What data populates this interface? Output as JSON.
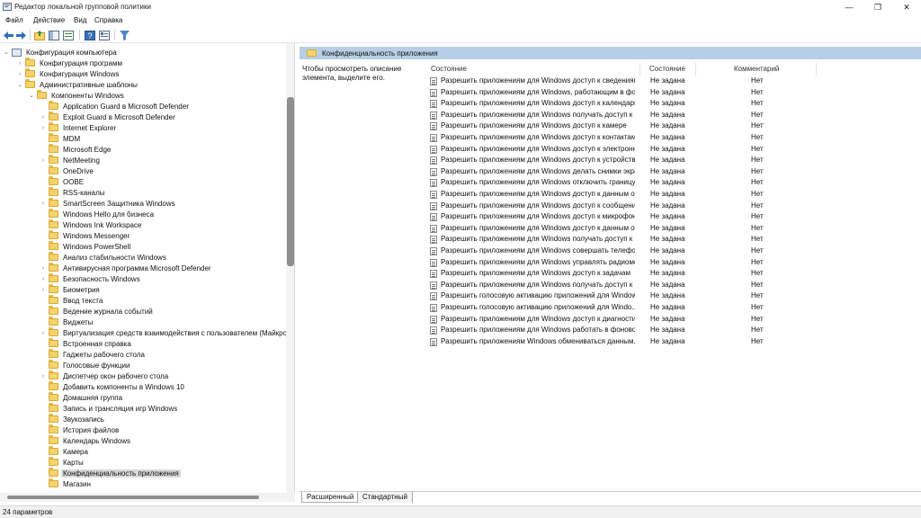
{
  "window": {
    "title": "Редактор локальной групповой политики",
    "controls": {
      "minimize": "—",
      "maximize": "❐",
      "close": "✕"
    }
  },
  "menu": [
    "Файл",
    "Действие",
    "Вид",
    "Справка"
  ],
  "toolbar": {
    "icons": [
      "back-arrow-icon",
      "forward-arrow-icon",
      "up-folder-icon",
      "show-hide-tree-icon",
      "export-list-icon",
      "help-icon",
      "properties-icon",
      "filter-icon"
    ]
  },
  "tree": [
    {
      "label": "Конфигурация компьютера",
      "level": 0,
      "exp": "⌄",
      "icon": "computer"
    },
    {
      "label": "Конфигурация программ",
      "level": 1,
      "exp": "›",
      "icon": "folder"
    },
    {
      "label": "Конфигурация Windows",
      "level": 1,
      "exp": "›",
      "icon": "folder"
    },
    {
      "label": "Административные шаблоны",
      "level": 1,
      "exp": "⌄",
      "icon": "folder"
    },
    {
      "label": "Компоненты Windows",
      "level": 2,
      "exp": "⌄",
      "icon": "folder"
    },
    {
      "label": "Application Guard в Microsoft Defender",
      "level": 3,
      "exp": "",
      "icon": "folder"
    },
    {
      "label": "Exploit Guard в Microsoft Defender",
      "level": 3,
      "exp": "›",
      "icon": "folder"
    },
    {
      "label": "Internet Explorer",
      "level": 3,
      "exp": "›",
      "icon": "folder"
    },
    {
      "label": "MDM",
      "level": 3,
      "exp": "",
      "icon": "folder"
    },
    {
      "label": "Microsoft Edge",
      "level": 3,
      "exp": "",
      "icon": "folder"
    },
    {
      "label": "NetMeeting",
      "level": 3,
      "exp": "›",
      "icon": "folder"
    },
    {
      "label": "OneDrive",
      "level": 3,
      "exp": "",
      "icon": "folder"
    },
    {
      "label": "OOBE",
      "level": 3,
      "exp": "",
      "icon": "folder"
    },
    {
      "label": "RSS-каналы",
      "level": 3,
      "exp": "",
      "icon": "folder"
    },
    {
      "label": "SmartScreen Защитника Windows",
      "level": 3,
      "exp": "›",
      "icon": "folder"
    },
    {
      "label": "Windows Hello для бизнеса",
      "level": 3,
      "exp": "",
      "icon": "folder"
    },
    {
      "label": "Windows Ink Workspace",
      "level": 3,
      "exp": "",
      "icon": "folder"
    },
    {
      "label": "Windows Messenger",
      "level": 3,
      "exp": "",
      "icon": "folder"
    },
    {
      "label": "Windows PowerShell",
      "level": 3,
      "exp": "",
      "icon": "folder"
    },
    {
      "label": "Анализ стабильности Windows",
      "level": 3,
      "exp": "",
      "icon": "folder"
    },
    {
      "label": "Антивирусная программа Microsoft Defender",
      "level": 3,
      "exp": "›",
      "icon": "folder"
    },
    {
      "label": "Безопасность Windows",
      "level": 3,
      "exp": "›",
      "icon": "folder"
    },
    {
      "label": "Биометрия",
      "level": 3,
      "exp": "›",
      "icon": "folder"
    },
    {
      "label": "Ввод текста",
      "level": 3,
      "exp": "",
      "icon": "folder"
    },
    {
      "label": "Ведение журнала событий",
      "level": 3,
      "exp": "",
      "icon": "folder"
    },
    {
      "label": "Виджеты",
      "level": 3,
      "exp": "",
      "icon": "folder"
    },
    {
      "label": "Виртуализация средств взаимодействия с пользователем (Майкрософ",
      "level": 3,
      "exp": "›",
      "icon": "folder"
    },
    {
      "label": "Встроенная справка",
      "level": 3,
      "exp": "",
      "icon": "folder"
    },
    {
      "label": "Гаджеты рабочего стола",
      "level": 3,
      "exp": "",
      "icon": "folder"
    },
    {
      "label": "Голосовые функции",
      "level": 3,
      "exp": "",
      "icon": "folder"
    },
    {
      "label": "Диспетчер окон рабочего стола",
      "level": 3,
      "exp": "›",
      "icon": "folder"
    },
    {
      "label": "Добавить компоненты в Windows 10",
      "level": 3,
      "exp": "",
      "icon": "folder"
    },
    {
      "label": "Домашняя группа",
      "level": 3,
      "exp": "",
      "icon": "folder"
    },
    {
      "label": "Запись и трансляция игр Windows",
      "level": 3,
      "exp": "",
      "icon": "folder"
    },
    {
      "label": "Звукозапись",
      "level": 3,
      "exp": "",
      "icon": "folder"
    },
    {
      "label": "История файлов",
      "level": 3,
      "exp": "",
      "icon": "folder"
    },
    {
      "label": "Календарь Windows",
      "level": 3,
      "exp": "",
      "icon": "folder"
    },
    {
      "label": "Камера",
      "level": 3,
      "exp": "",
      "icon": "folder"
    },
    {
      "label": "Карты",
      "level": 3,
      "exp": "",
      "icon": "folder"
    },
    {
      "label": "Конфиденциальность приложения",
      "level": 3,
      "exp": "",
      "icon": "folder",
      "selected": true
    },
    {
      "label": "Магазин",
      "level": 3,
      "exp": "",
      "icon": "folder"
    }
  ],
  "right": {
    "header": "Конфиденциальность приложения",
    "description": "Чтобы просмотреть описание элемента, выделите его.",
    "columns": {
      "setting": "Состояние",
      "state": "Состояние",
      "comment": "Комментарий"
    },
    "rows": [
      {
        "name": "Разрешить приложениям для Windows доступ к сведениям...",
        "state": "Не задана",
        "comment": "Нет"
      },
      {
        "name": "Разрешить приложениям для Windows, работающим в фо...",
        "state": "Не задана",
        "comment": "Нет"
      },
      {
        "name": "Разрешить приложениям для Windows доступ к календарю",
        "state": "Не задана",
        "comment": "Нет"
      },
      {
        "name": "Разрешить приложениям для Windows получать доступ к ...",
        "state": "Не задана",
        "comment": "Нет"
      },
      {
        "name": "Разрешить приложениям для Windows доступ к камере",
        "state": "Не задана",
        "comment": "Нет"
      },
      {
        "name": "Разрешить приложениям для Windows доступ к контактам",
        "state": "Не задана",
        "comment": "Нет"
      },
      {
        "name": "Разрешить приложениям для Windows доступ к электронн...",
        "state": "Не задана",
        "comment": "Нет"
      },
      {
        "name": "Разрешить приложениям для Windows доступ к устройств...",
        "state": "Не задана",
        "comment": "Нет"
      },
      {
        "name": "Разрешить приложениям для Windows делать снимки экра...",
        "state": "Не задана",
        "comment": "Нет"
      },
      {
        "name": "Разрешить приложениям для Windows отключить границу...",
        "state": "Не задана",
        "comment": "Нет"
      },
      {
        "name": "Разрешить приложениям для Windows доступ к данным о ...",
        "state": "Не задана",
        "comment": "Нет"
      },
      {
        "name": "Разрешить приложениям для Windows доступ к сообщени...",
        "state": "Не задана",
        "comment": "Нет"
      },
      {
        "name": "Разрешить приложениям для Windows доступ к микрофону",
        "state": "Не задана",
        "comment": "Нет"
      },
      {
        "name": "Разрешить приложениям для Windows доступ к данным о ...",
        "state": "Не задана",
        "comment": "Нет"
      },
      {
        "name": "Разрешить приложениям для Windows получать доступ к ...",
        "state": "Не задана",
        "comment": "Нет"
      },
      {
        "name": "Разрешить приложениям для Windows совершать телефон...",
        "state": "Не задана",
        "comment": "Нет"
      },
      {
        "name": "Разрешить приложениям для Windows управлять радиомо...",
        "state": "Не задана",
        "comment": "Нет"
      },
      {
        "name": "Разрешить приложениям для Windows доступ к задачам",
        "state": "Не задана",
        "comment": "Нет"
      },
      {
        "name": "Разрешить приложениям для Windows получать доступ к ...",
        "state": "Не задана",
        "comment": "Нет"
      },
      {
        "name": "Разрешить голосовую активацию приложений для Windows",
        "state": "Не задана",
        "comment": "Нет"
      },
      {
        "name": "Разрешить голосовую активацию приложений для Windo...",
        "state": "Не задана",
        "comment": "Нет"
      },
      {
        "name": "Разрешить приложениям для Windows доступ к диагности...",
        "state": "Не задана",
        "comment": "Нет"
      },
      {
        "name": "Разрешить приложениям для Windows работать в фоново...",
        "state": "Не задана",
        "comment": "Нет"
      },
      {
        "name": "Разрешить приложениям Windows обмениваться данным...",
        "state": "Не задана",
        "comment": "Нет"
      }
    ]
  },
  "tabs": [
    "Расширенный",
    "Стандартный"
  ],
  "status": "24 параметров"
}
